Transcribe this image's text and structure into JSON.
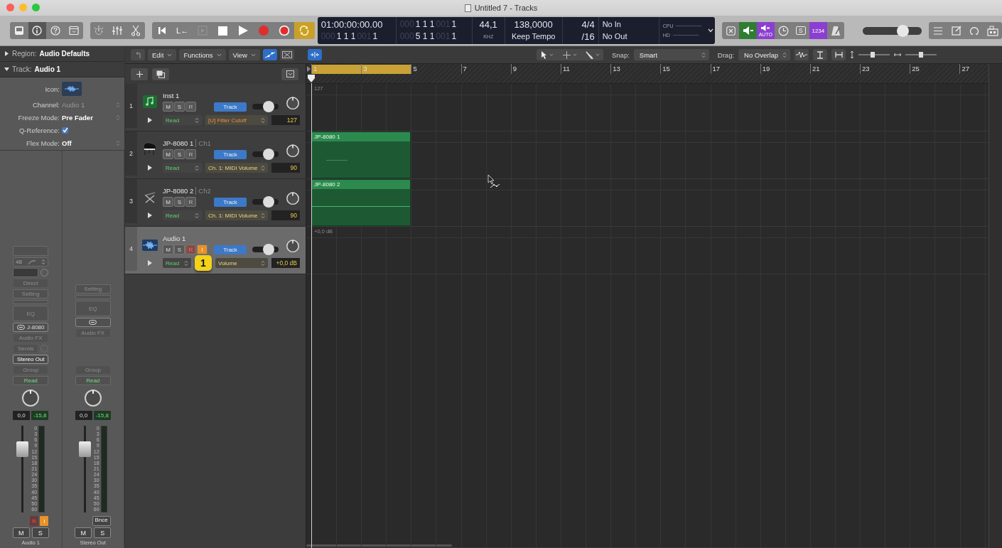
{
  "window": {
    "title": "Untitled 7 - Tracks"
  },
  "control_bar": {
    "view_buttons": [
      {
        "kind": "library",
        "selected": false
      },
      {
        "kind": "inspector",
        "selected": true
      },
      {
        "kind": "quick_help",
        "selected": false
      },
      {
        "kind": "toolbar",
        "selected": false
      }
    ],
    "edit_buttons": [
      {
        "kind": "smart_controls",
        "selected": false
      },
      {
        "kind": "mixer",
        "selected": false
      },
      {
        "kind": "editors",
        "selected": false
      }
    ],
    "transport": [
      {
        "kind": "rewind",
        "on": false,
        "disabled": false
      },
      {
        "kind": "go_to_left",
        "label": "L←",
        "on": false,
        "disabled": false
      },
      {
        "kind": "forward",
        "on": false,
        "disabled": true
      },
      {
        "kind": "stop",
        "on": false,
        "disabled": false
      },
      {
        "kind": "play",
        "on": false,
        "disabled": false
      },
      {
        "kind": "record",
        "on": false,
        "disabled": false
      },
      {
        "kind": "replace",
        "on": false,
        "disabled": false
      },
      {
        "kind": "cycle",
        "on": true,
        "disabled": false
      }
    ],
    "lcd": {
      "time": "01:00:00:00.00",
      "position": [
        {
          "text": "000",
          "dim": true
        },
        {
          "text": "1  1  1",
          "dim": false
        },
        {
          "text": "001",
          "dim": true
        },
        {
          "text": "1",
          "dim": false
        }
      ],
      "left_locator": [
        {
          "text": "000",
          "dim": true
        },
        {
          "text": "1  1  1",
          "dim": false
        },
        {
          "text": "001",
          "dim": true
        },
        {
          "text": "1",
          "dim": false
        }
      ],
      "right_locator": [
        {
          "text": "000",
          "dim": true
        },
        {
          "text": "5  1  1",
          "dim": false
        },
        {
          "text": "001",
          "dim": true
        },
        {
          "text": "1",
          "dim": false
        }
      ],
      "sample_rate": "44,1",
      "sample_rate_unit": "KHZ",
      "tempo": "138,0000",
      "tempo_mode": "Keep Tempo",
      "signature": "4/4",
      "division": "/16",
      "midi_in": "No In",
      "midi_out": "No Out",
      "cpu_label": "CPU",
      "hd_label": "HD"
    },
    "mode_buttons": [
      {
        "kind": "count_in",
        "on": false
      },
      {
        "kind": "low_latency",
        "on": true
      },
      {
        "kind": "auto_input",
        "label": "AUTO",
        "on": true
      },
      {
        "kind": "clock",
        "on": false
      },
      {
        "kind": "solo",
        "label": "S",
        "on": false
      },
      {
        "kind": "varispeed",
        "label": "1234",
        "on": true
      },
      {
        "kind": "metronome",
        "on": false
      }
    ],
    "master_volume": {
      "level": 0.72
    },
    "window_buttons": [
      {
        "kind": "list"
      },
      {
        "kind": "notes"
      },
      {
        "kind": "loops"
      },
      {
        "kind": "browser"
      }
    ]
  },
  "inspector": {
    "sections": [
      {
        "label": "Region:",
        "value": "Audio Defaults",
        "expanded": false
      },
      {
        "label": "Track:",
        "value": "Audio 1",
        "expanded": true
      }
    ],
    "icon_label": "Icon:",
    "fields": [
      {
        "kind": "popup",
        "label": "Channel:",
        "value": "Audio 1",
        "disabled": true
      },
      {
        "kind": "popup",
        "label": "Freeze Mode:",
        "value": "Pre Fader",
        "disabled": false
      },
      {
        "kind": "checkbox",
        "label": "Q-Reference:",
        "checked": true
      },
      {
        "kind": "popup",
        "label": "Flex Mode:",
        "value": "Off",
        "disabled": false
      }
    ],
    "strips": [
      {
        "name": "Audio 1",
        "input_rate": "48",
        "input_mode": "Direct",
        "setting": "Setting",
        "eq": "EQ",
        "insert": "J-8080",
        "audio_fx": "Audio FX",
        "sends": "Sends",
        "output": "Stereo Out",
        "group": "Group",
        "automation": "Read",
        "volume": "0,0",
        "peak": "-15,8",
        "level": 0.78,
        "meter_scale": [
          "0",
          "3",
          "6",
          "9",
          "12",
          "15",
          "18",
          "21",
          "24",
          "30",
          "35",
          "40",
          "45",
          "50",
          "60"
        ],
        "record": {
          "label": "R",
          "on": false
        },
        "input": {
          "label": "I",
          "on": true
        },
        "mute": {
          "label": "M",
          "on": false
        },
        "solo": {
          "label": "S",
          "on": false
        }
      },
      {
        "name": "Stereo Out",
        "setting": "Setting",
        "eq": "EQ",
        "audio_fx": "Audio FX",
        "group": "Group",
        "automation": "Read",
        "volume": "0,0",
        "peak": "-15,8",
        "level": 0.78,
        "meter_scale": [
          "0",
          "3",
          "6",
          "9",
          "12",
          "15",
          "18",
          "21",
          "24",
          "30",
          "35",
          "40",
          "45",
          "50",
          "60"
        ],
        "bounce": "Bnce",
        "mute": {
          "label": "M",
          "on": false
        },
        "solo": {
          "label": "S",
          "on": false
        }
      }
    ]
  },
  "tracks_toolbar": {
    "menus": [
      "Edit",
      "Functions",
      "View"
    ],
    "automation_on": true,
    "flex_on": false,
    "catch_on": true,
    "tools": [
      {
        "kind": "pointer"
      },
      {
        "kind": "marquee"
      },
      {
        "kind": "pencil"
      }
    ],
    "snap_label": "Snap:",
    "snap": "Smart",
    "drag_label": "Drag:",
    "drag": "No Overlap",
    "vertical_zoom": {
      "level": 0.45
    },
    "horizontal_zoom": {
      "level": 0.5
    }
  },
  "ruler": {
    "bars": [
      "1",
      "3",
      "5",
      "7",
      "9",
      "11",
      "13",
      "15",
      "17",
      "19",
      "21",
      "23",
      "25",
      "27"
    ],
    "cycle_on": true
  },
  "tracks": [
    {
      "number": "1",
      "kind": "instrument",
      "name": "Inst 1",
      "selected": false,
      "buttons": [
        {
          "label": "M",
          "kind": "mute",
          "on": false
        },
        {
          "label": "S",
          "kind": "solo",
          "on": false
        },
        {
          "label": "R",
          "kind": "record",
          "on": false
        }
      ],
      "group_button": "Track",
      "level": 0.72,
      "automation": "Read",
      "parameter": "[U] Filter Cutoff",
      "parameter_unassigned": true,
      "value": "127",
      "lane_value": "127"
    },
    {
      "number": "2",
      "kind": "piano",
      "name": "JP-8080 1",
      "channel": "Ch1",
      "selected": false,
      "buttons": [
        {
          "label": "M",
          "kind": "mute",
          "on": false
        },
        {
          "label": "S",
          "kind": "solo",
          "on": false
        },
        {
          "label": "R",
          "kind": "record",
          "on": false
        }
      ],
      "group_button": "Track",
      "level": 0.72,
      "automation": "Read",
      "parameter": "Ch. 1: MIDI Volume",
      "parameter_unassigned": false,
      "value": "90",
      "region": {
        "name": "JP-8080 1",
        "kind": "notes"
      }
    },
    {
      "number": "3",
      "kind": "keyboard",
      "name": "JP-8080 2",
      "channel": "Ch2",
      "selected": false,
      "buttons": [
        {
          "label": "M",
          "kind": "mute",
          "on": false
        },
        {
          "label": "S",
          "kind": "solo",
          "on": false
        },
        {
          "label": "R",
          "kind": "record",
          "on": false
        }
      ],
      "group_button": "Track",
      "level": 0.72,
      "automation": "Read",
      "parameter": "Ch. 1: MIDI Volume",
      "parameter_unassigned": false,
      "value": "90",
      "region": {
        "name": "JP-8080 2",
        "kind": "line"
      }
    },
    {
      "number": "4",
      "kind": "audio",
      "name": "Audio 1",
      "selected": true,
      "buttons": [
        {
          "label": "M",
          "kind": "mute",
          "on": false
        },
        {
          "label": "S",
          "kind": "solo",
          "on": false
        },
        {
          "label": "R",
          "kind": "record",
          "on": false
        },
        {
          "label": "I",
          "kind": "input",
          "on": true
        }
      ],
      "group_button": "Track",
      "level": 0.72,
      "automation": "Read",
      "parameter": "Volume",
      "parameter_unassigned": false,
      "value": "+0,0 dB",
      "lane_value": "+0,0 dB",
      "callout": "1"
    }
  ]
}
